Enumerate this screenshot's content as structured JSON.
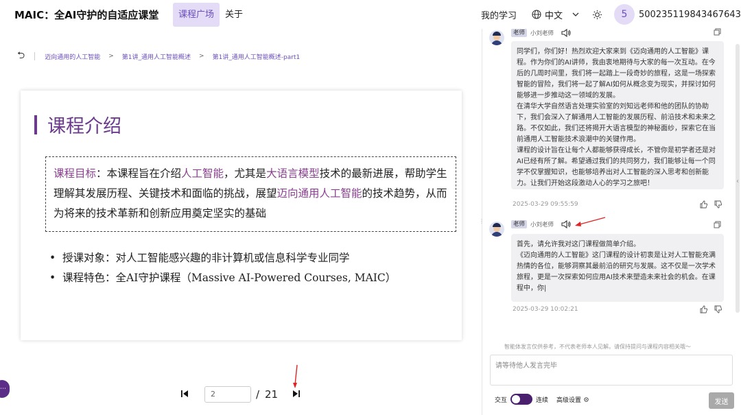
{
  "header": {
    "brand": "MAIC：全AI守护的自适应课堂",
    "tabs": [
      {
        "label": "课程广场",
        "active": true
      },
      {
        "label": "关于",
        "active": false
      }
    ],
    "my_learning": "我的学习",
    "language": "中文",
    "user_avatar": "5",
    "user_id": "500235119843467643"
  },
  "breadcrumb": {
    "items": [
      "迈向通用的人工智能",
      "第1讲_通用人工智能概述",
      "第1讲_通用人工智能概述-part1"
    ],
    "separator": ">"
  },
  "slide": {
    "title": "课程介绍",
    "goal": {
      "label": "课程目标",
      "p1": "：本课程旨在介绍",
      "hl1": "人工智能",
      "p2": "，尤其是",
      "hl2": "大语言模型",
      "p3": "技术的最新进展，帮助学生理解其发展历程、关键技术和面临的挑战，展望",
      "hl3": "迈向通用人工智能",
      "p4": "的技术趋势，从而为将来的技术革新和创新应用奠定坚实的基础"
    },
    "bullets": [
      "授课对象：对人工智能感兴趣的非计算机或信息科学专业同学",
      "课程特色：全AI守护课程（Massive AI-Powered Courses, MAIC）"
    ]
  },
  "pager": {
    "current": "2",
    "separator": "/",
    "total": "21"
  },
  "chat": {
    "messages": [
      {
        "role": "老师",
        "name": "小刘老师",
        "paragraphs": [
          "同学们，你们好！热烈欢迎大家来到《迈向通用的人工智能》课程。作为你们的AI讲师，我由衷地期待与大家的每一次互动。在今后的几周时间里，我们将一起踏上一段奇妙的旅程，这是一场探索智能的冒险，我们将一起了解AI如何从概念变为现实，并探讨如何能够进一步推动这一领域的发展。",
          "在清华大学自然语言处理实验室的刘知远老师和他的团队的协助下，我们会深入了解通用人工智能的发展历程、前沿技术和未来之路。不仅如此，我们还将揭开大语言模型的神秘面纱，探索它在当前通用人工智能技术浪潮中的关键作用。",
          "课程的设计旨在让每个人都能够获得成长，不管你是初学者还是对AI已经有所了解。希望通过我们的共同努力，我们能够让每一个同学不仅掌握知识，也能够培养出对人工智能的深入思考和创新能力。让我们开始这段激动人心的学习之旅吧！"
        ],
        "time": "2025-03-29 09:55:59"
      },
      {
        "role": "老师",
        "name": "小刘老师",
        "paragraphs": [
          "首先，请允许我对这门课程做简单介绍。",
          "《迈向通用的人工智能》这门课程的设计初衷是让对人工智能充满热情的各位，能够洞察其最前沿的研究与发展。这不仅是一次学术旅程，更是一次探索如何应用AI技术来塑造未来社会的机会。在课程中，你|"
        ],
        "time": "2025-03-29 10:02:21"
      }
    ],
    "disclaimer": "智能体发言仅供参考，不代表老师本人见解。请保持提问与课程内容相关哦～",
    "input_placeholder": "请等待他人发言完毕",
    "interact_label": "交互",
    "continuous_label": "连续",
    "advanced_label": "高级设置",
    "send_label": "发送",
    "toggle_on": true
  },
  "colors": {
    "accent": "#6b4fbf",
    "slide_accent": "#6b3a8c",
    "highlight": "#8a3f90",
    "annotation_arrow": "#e02424"
  }
}
